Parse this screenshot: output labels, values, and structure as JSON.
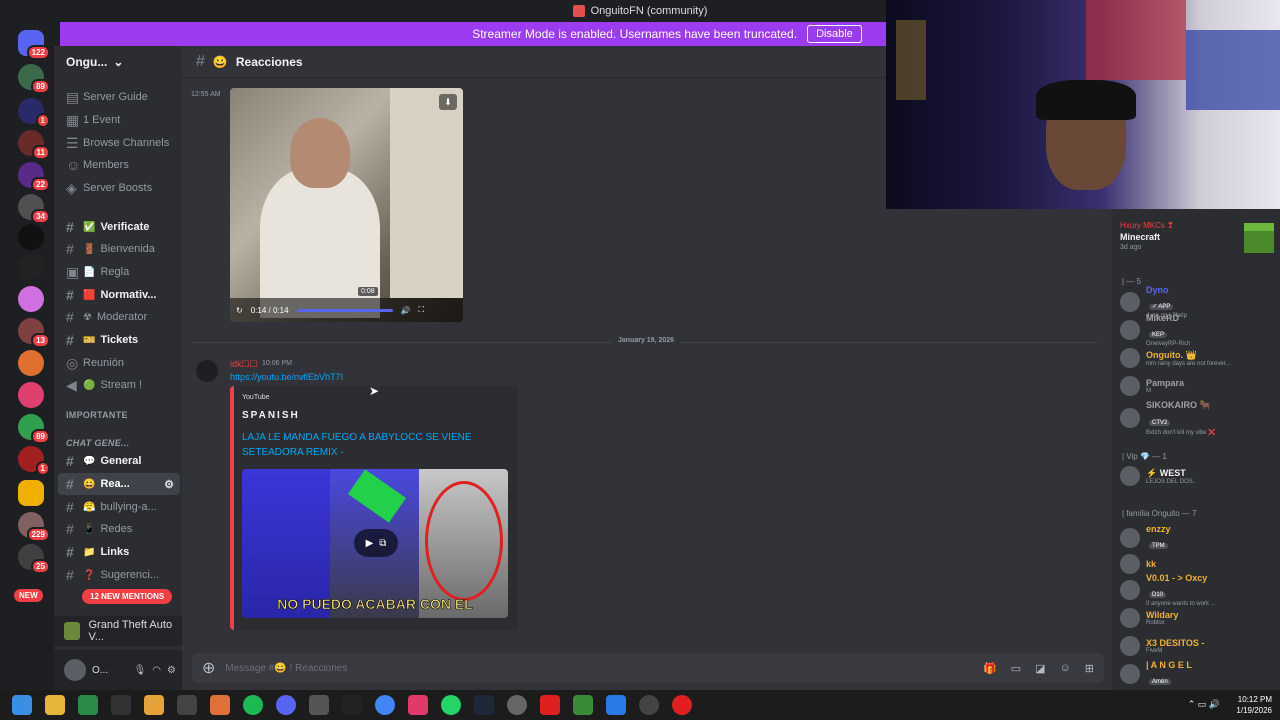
{
  "window": {
    "title": "OnguitoFN (community)"
  },
  "banner": {
    "text": "Streamer Mode is enabled. Usernames have been truncated.",
    "disable_label": "Disable",
    "close": "×"
  },
  "servers": {
    "badges": [
      "122",
      "89",
      "1",
      "11",
      "22",
      "34",
      "13",
      "89",
      "1",
      "229",
      "25"
    ],
    "new_label": "NEW"
  },
  "guild": {
    "name": "Ongu...",
    "chevron": "⌄"
  },
  "nav": {
    "server_guide": "Server Guide",
    "events": "1 Event",
    "browse": "Browse Channels",
    "members": "Members",
    "boosts": "Server Boosts"
  },
  "channels": [
    {
      "label": "Verificate",
      "emoji": "✅",
      "bold": true
    },
    {
      "label": "Bienvenida",
      "emoji": "🚪",
      "bold": false
    },
    {
      "label": "Regla",
      "emoji": "📄",
      "bold": false
    },
    {
      "label": "Normativ...",
      "emoji": "🟥",
      "bold": true
    },
    {
      "label": "Moderator",
      "emoji": "☢",
      "bold": false
    },
    {
      "label": "Tickets",
      "emoji": "🎫",
      "bold": true
    },
    {
      "label": "Reunión",
      "emoji": "",
      "bold": false
    },
    {
      "label": "Stream !",
      "emoji": "🟢",
      "bold": false
    }
  ],
  "categories": {
    "importante": "IMPORTANTE",
    "chat_general": "CHAT GENE..."
  },
  "channels2": [
    {
      "label": "General",
      "emoji": "💬"
    },
    {
      "label": "Rea...",
      "emoji": "😀"
    },
    {
      "label": "bullying-a...",
      "emoji": "😤"
    },
    {
      "label": "Redes",
      "emoji": "📱"
    },
    {
      "label": "Links",
      "emoji": "📁"
    },
    {
      "label": "Sugerenci...",
      "emoji": "❓"
    }
  ],
  "mentions_label": "12 NEW MENTIONS",
  "activity": {
    "game": "Grand Theft Auto V..."
  },
  "user": {
    "name": "O..."
  },
  "header": {
    "channel": "Reacciones",
    "emoji": "😀"
  },
  "message1": {
    "time": "12:55 AM",
    "video": {
      "time": "0:14 / 0:14",
      "scrub": "0:08",
      "progress": 1.0
    }
  },
  "date_divider": "January 19, 2026",
  "message2": {
    "author": "idk☐☐",
    "time": "10:06 PM",
    "link": "https://youtu.be/nvflEbVhT7I",
    "embed": {
      "provider": "YouTube",
      "author": "SPANISH",
      "title": "LAJA LE MANDA FUEGO A BABYLOCC SE VIENE SETEADORA REMIX -",
      "caption": "NO PUEDO ACABAR CON EL"
    }
  },
  "composer": {
    "placeholder": "Message #😀 ! Reacciones"
  },
  "member_list": {
    "card": {
      "user": "Hxury MKCs ❣",
      "game": "Minecraft",
      "ago": "3d ago"
    },
    "groups": [
      "| — 5",
      "| Vip 💎 — 1",
      "| familia Onguito — 7"
    ],
    "members": [
      {
        "name": "Dyno",
        "tag": "✓ APP",
        "status": "dyno.gg | ?help",
        "color": "#5865f2"
      },
      {
        "name": "MikeRD",
        "tag": "KEP",
        "status": "OnewayRP-Rich",
        "color": "#a0a0a0"
      },
      {
        "name": "Onguito. 👑",
        "tag": "",
        "status": "mm rainy days are not forever...",
        "color": "#f0b232"
      },
      {
        "name": "Pampara",
        "tag": "",
        "status": "M",
        "color": "#a0a0a0"
      },
      {
        "name": "SIKOKAIRO 🐂",
        "tag": "CTV2",
        "status": "Bxtch don't kill my vibe ❌",
        "color": "#a0a0a0"
      },
      {
        "name": "⚡ WEST",
        "tag": "",
        "status": "LEJOS DEL DOS..",
        "color": "#f2f3f5"
      },
      {
        "name": "enzzy",
        "tag": "TPM",
        "status": "",
        "color": "#f0b232"
      },
      {
        "name": "kk",
        "tag": "",
        "status": "",
        "color": "#f0b232"
      },
      {
        "name": "V0.01 - > Oxcy",
        "tag": "D10",
        "status": "If anyone wants to work ...",
        "color": "#f0b232"
      },
      {
        "name": "Wildary",
        "tag": "",
        "status": "Roblox",
        "color": "#f0b232"
      },
      {
        "name": "X3 DESITOS -",
        "tag": "",
        "status": "FiveM",
        "color": "#f0b232"
      },
      {
        "name": "| A N G E L",
        "tag": "Amén",
        "status": "",
        "color": "#f0b232"
      }
    ]
  },
  "clock": {
    "time": "10:12 PM",
    "date": "1/19/2026"
  },
  "colors": {
    "accent": "#5865f2",
    "banner": "#9b3cf0",
    "mention": "#f23f43"
  }
}
